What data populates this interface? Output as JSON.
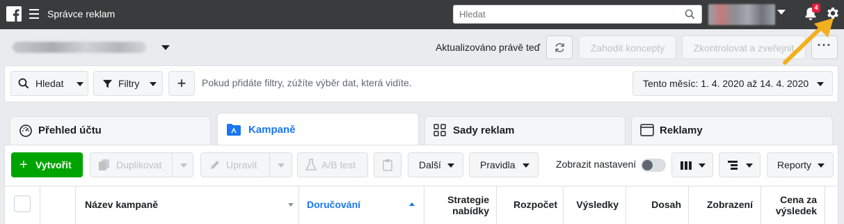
{
  "topbar": {
    "app_title": "Správce reklam",
    "search_placeholder": "Hledat",
    "notification_count": "4"
  },
  "account_bar": {
    "updated_text": "Aktualizováno právě teď",
    "discard_label": "Zahodit koncepty",
    "review_publish_label": "Zkontrolovat a zveřejnit",
    "more_label": "···"
  },
  "filters": {
    "search_label": "Hledat",
    "filters_label": "Filtry",
    "add_label": "+",
    "hint": "Pokud přidáte filtry, zúžíte výběr dat, která vidíte.",
    "date_range": "Tento měsíc: 1. 4. 2020 až 14. 4. 2020"
  },
  "tabs": [
    {
      "label": "Přehled účtu",
      "active": false
    },
    {
      "label": "Kampaně",
      "active": true
    },
    {
      "label": "Sady reklam",
      "active": false
    },
    {
      "label": "Reklamy",
      "active": false
    }
  ],
  "toolbar": {
    "create_label": "Vytvořit",
    "duplicate_label": "Duplikovat",
    "edit_label": "Upravit",
    "ab_test_label": "A/B test",
    "more_label": "Další",
    "rules_label": "Pravidla",
    "show_settings_label": "Zobrazit nastavení",
    "reports_label": "Reporty"
  },
  "table": {
    "columns": [
      {
        "label": "Název kampaně"
      },
      {
        "label": "Doručování"
      },
      {
        "label_line1": "Strategie",
        "label_line2": "nabídky"
      },
      {
        "label": "Rozpočet"
      },
      {
        "label": "Výsledky"
      },
      {
        "label": "Dosah"
      },
      {
        "label": "Zobrazení"
      },
      {
        "label_line1": "Cena za",
        "label_line2": "výsledek"
      }
    ]
  },
  "colors": {
    "topbar": "#3a3b3c",
    "create_button": "#00a400",
    "active_tab": "#1877f2",
    "arrow": "#f2b01e",
    "badge": "#e41e3f"
  }
}
